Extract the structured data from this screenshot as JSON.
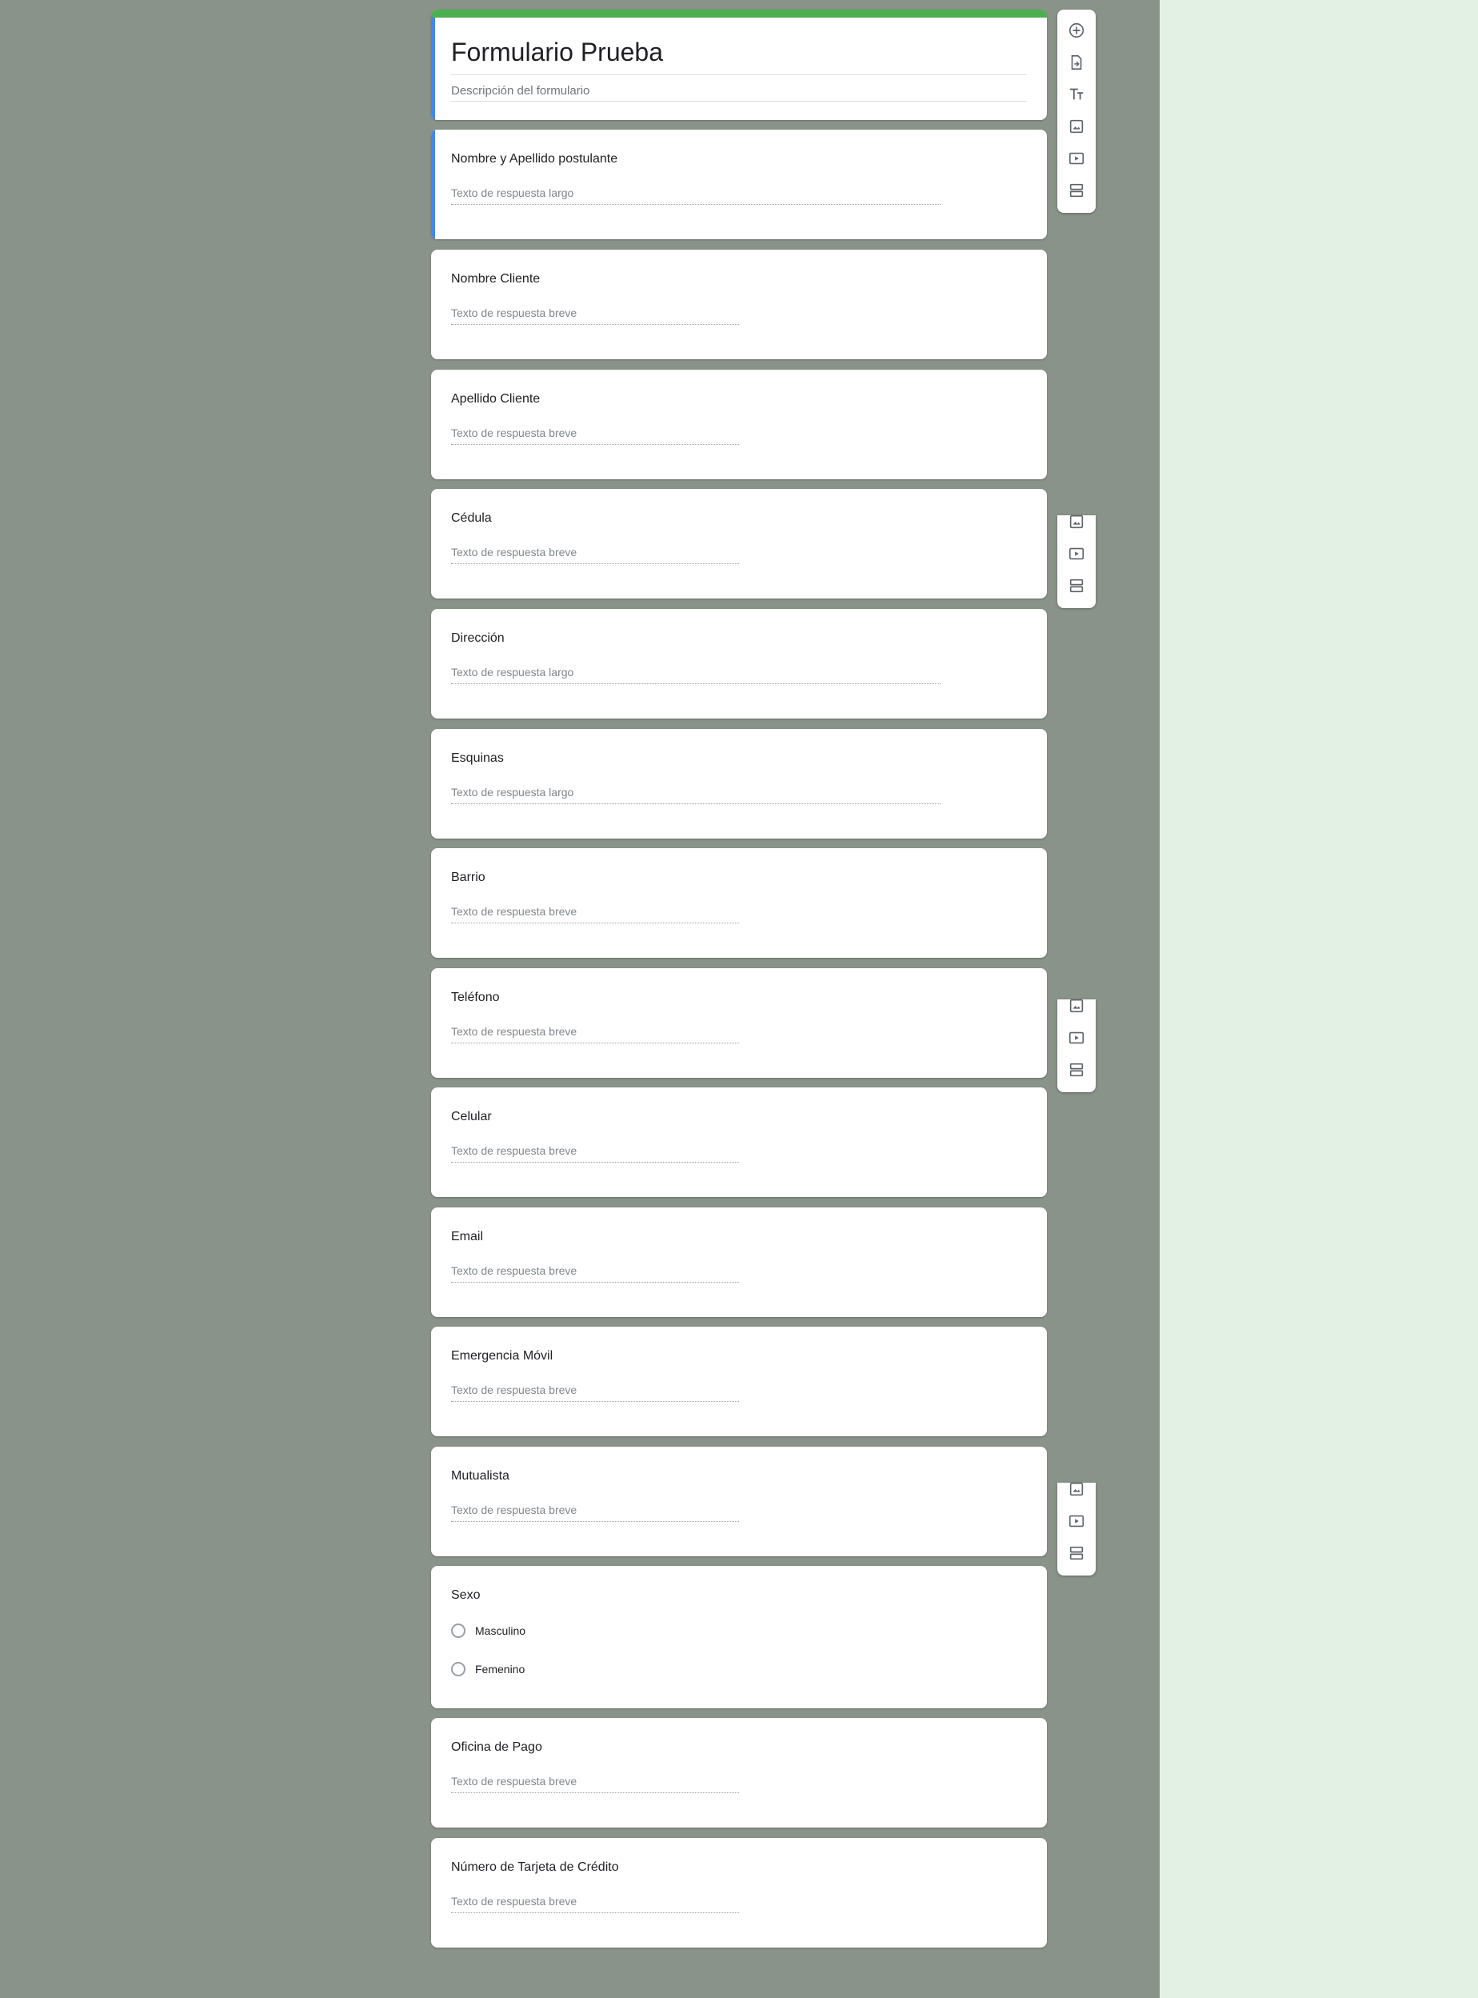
{
  "colors": {
    "workspace_background": "#8a9389",
    "side_background": "#e3f1e4",
    "theme_green": "#4caf50",
    "active_blue": "#4285f4"
  },
  "form": {
    "title": "Formulario Prueba",
    "description_placeholder": "Descripción del formulario"
  },
  "toolbar": {
    "icons": [
      "add-question-icon",
      "import-questions-icon",
      "add-title-icon",
      "add-image-icon",
      "add-video-icon",
      "add-section-icon"
    ]
  },
  "questions": [
    {
      "title": "Nombre y Apellido postulante",
      "placeholder": "Texto de respuesta largo"
    },
    {
      "title": "Nombre Cliente",
      "placeholder": "Texto de respuesta breve"
    },
    {
      "title": "Apellido Cliente",
      "placeholder": "Texto de respuesta breve"
    },
    {
      "title": "Cédula",
      "placeholder": "Texto de respuesta breve"
    },
    {
      "title": "Dirección",
      "placeholder": "Texto de respuesta largo"
    },
    {
      "title": "Esquinas",
      "placeholder": "Texto de respuesta largo"
    },
    {
      "title": "Barrio",
      "placeholder": "Texto de respuesta breve"
    },
    {
      "title": "Teléfono",
      "placeholder": "Texto de respuesta breve"
    },
    {
      "title": "Celular",
      "placeholder": "Texto de respuesta breve"
    },
    {
      "title": "Email",
      "placeholder": "Texto de respuesta breve"
    },
    {
      "title": "Emergencia Móvil",
      "placeholder": "Texto de respuesta breve"
    },
    {
      "title": "Mutualista",
      "placeholder": "Texto de respuesta breve"
    },
    {
      "title": "Sexo",
      "options": [
        "Masculino",
        "Femenino"
      ]
    },
    {
      "title": "Oficina de Pago",
      "placeholder": "Texto de respuesta breve"
    },
    {
      "title": "Número de Tarjeta de Crédito",
      "placeholder": "Texto de respuesta breve"
    }
  ]
}
